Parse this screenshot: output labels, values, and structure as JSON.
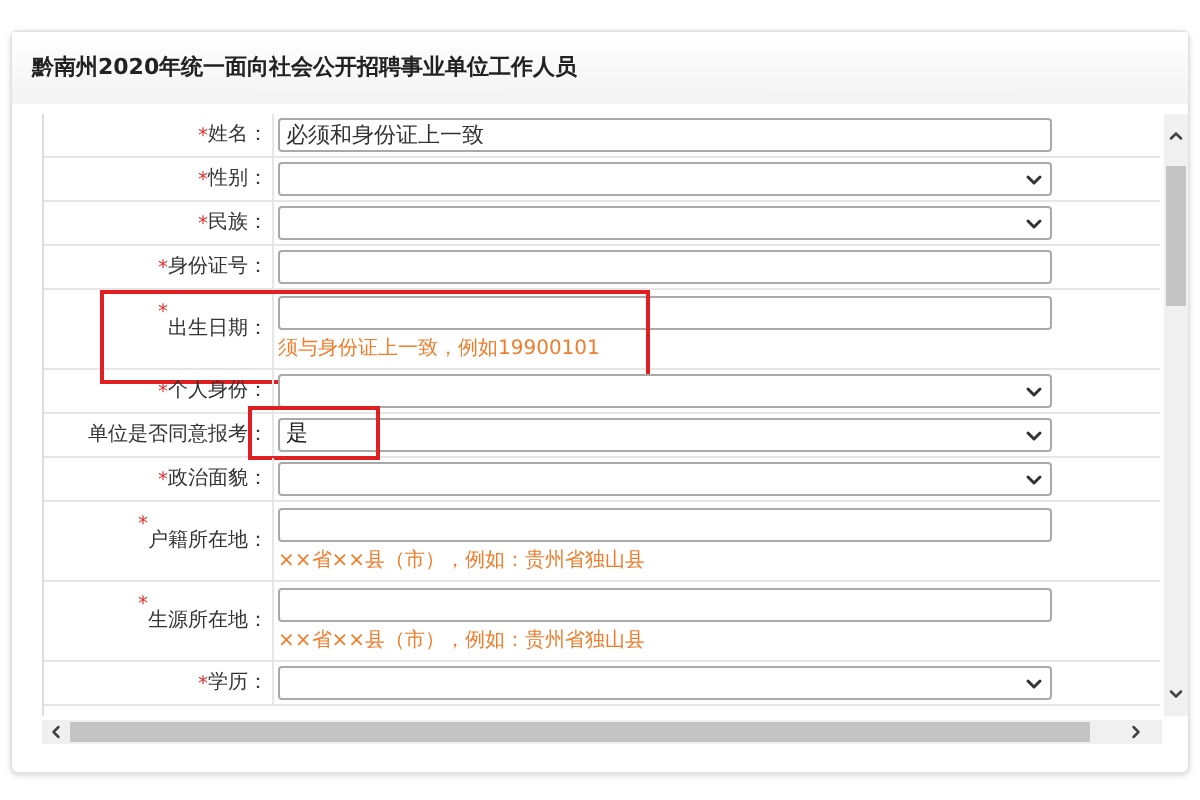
{
  "title": "黔南州2020年统一面向社会公开招聘事业单位工作人员",
  "fields": [
    {
      "mark": "*",
      "label": "姓名：",
      "kind": "text",
      "value": "必须和身份证上一致",
      "highlighted": false
    },
    {
      "mark": "*",
      "label": "性别：",
      "kind": "select",
      "highlighted": false
    },
    {
      "mark": "*",
      "label": "民族：",
      "kind": "select",
      "highlighted": false
    },
    {
      "mark": "*",
      "label": "身份证号：",
      "kind": "text",
      "highlighted": false
    },
    {
      "mark": "*",
      "label": "出生日期：",
      "kind": "text",
      "hint": "须与身份证上一致，例如19900101",
      "highlighted": true
    },
    {
      "mark": "*",
      "label": "个人身份：",
      "kind": "select",
      "highlighted": false
    },
    {
      "label": "单位是否同意报考：",
      "kind": "select",
      "value": "是",
      "value_highlighted": true,
      "highlighted": false
    },
    {
      "mark": "*",
      "label": "政治面貌：",
      "kind": "select",
      "highlighted": false
    },
    {
      "mark": "*",
      "label": "户籍所在地：",
      "kind": "text",
      "hint": "××省××县（市），例如：贵州省独山县",
      "highlighted": false
    },
    {
      "mark": "*",
      "label": "生源所在地：",
      "kind": "text",
      "hint": "××省××县（市），例如：贵州省独山县",
      "highlighted": false
    },
    {
      "mark": "*",
      "label": "学历：",
      "kind": "select",
      "highlighted": false
    }
  ]
}
